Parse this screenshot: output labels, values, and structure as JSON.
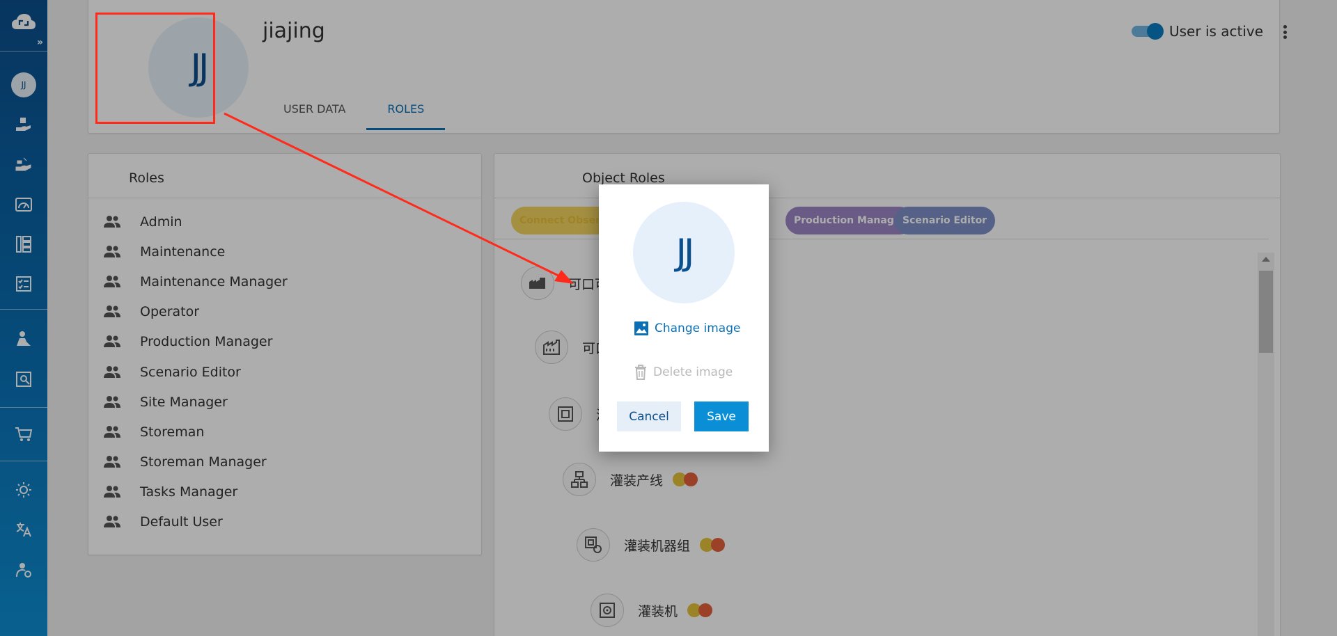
{
  "sidebar": {
    "expand_label": "»",
    "avatar_initials": "JJ",
    "icons": [
      "cloud-logo-icon",
      "user-avatar",
      "hand-product-icon",
      "hand-shake-icon",
      "dashboard-gauge-icon",
      "tree-hierarchy-icon",
      "task-checklist-icon",
      "user-roles-icon",
      "image-settings-icon",
      "cart-icon",
      "brightness-icon",
      "translate-icon",
      "user-logout-icon"
    ]
  },
  "header": {
    "avatar_initials": "JJ",
    "username": "jiajing",
    "tabs": [
      {
        "label": "USER DATA",
        "active": false
      },
      {
        "label": "ROLES",
        "active": true
      }
    ],
    "user_active_label": "User is active",
    "user_active": true
  },
  "roles_panel": {
    "title": "Roles",
    "items": [
      "Admin",
      "Maintenance",
      "Maintenance Manager",
      "Operator",
      "Production Manager",
      "Scenario Editor",
      "Site Manager",
      "Storeman",
      "Storeman Manager",
      "Tasks Manager",
      "Default User"
    ]
  },
  "object_roles": {
    "title": "Object Roles",
    "chips": [
      {
        "label": "Connect Observe",
        "color": "#f4d462"
      },
      {
        "label": "Production Manager",
        "color": "#9d87c6"
      },
      {
        "label": "Scenario Editor",
        "color": "#7e90c8"
      }
    ],
    "nodes": [
      {
        "label": "可口可",
        "icon": "factory-group-icon"
      },
      {
        "label": "可口",
        "icon": "factory-icon"
      },
      {
        "label": "灌",
        "icon": "area-icon"
      },
      {
        "label": "灌装产线",
        "icon": "production-line-icon"
      },
      {
        "label": "灌装机器组",
        "icon": "machine-group-icon"
      },
      {
        "label": "灌装机",
        "icon": "machine-icon"
      }
    ]
  },
  "dialog": {
    "avatar_initials": "JJ",
    "change_image_label": "Change image",
    "delete_image_label": "Delete image",
    "cancel_label": "Cancel",
    "save_label": "Save"
  },
  "colors": {
    "sidebar_top": "#0b4f8d",
    "sidebar_bottom": "#0e8fd3",
    "accent": "#0a8fd6",
    "annotation_red": "#ff2a1a",
    "dot_yellow": "#e5c13a",
    "dot_orange": "#e5603a"
  }
}
